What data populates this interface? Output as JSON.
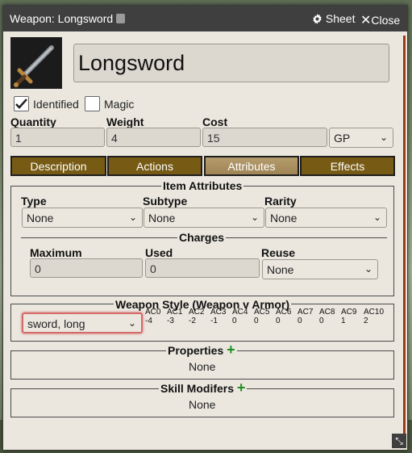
{
  "window": {
    "title": "Weapon: Longsword",
    "sheet_label": "Sheet",
    "close_label": "Close"
  },
  "item": {
    "name": "Longsword",
    "identified_label": "Identified",
    "identified": true,
    "magic_label": "Magic",
    "magic": false
  },
  "fields": {
    "quantity_label": "Quantity",
    "quantity": "1",
    "weight_label": "Weight",
    "weight": "4",
    "cost_label": "Cost",
    "cost": "15",
    "currency": "GP"
  },
  "tabs": [
    {
      "label": "Description"
    },
    {
      "label": "Actions"
    },
    {
      "label": "Attributes"
    },
    {
      "label": "Effects"
    }
  ],
  "attributes": {
    "title": "Item Attributes",
    "type_label": "Type",
    "type": "None",
    "subtype_label": "Subtype",
    "subtype": "None",
    "rarity_label": "Rarity",
    "rarity": "None"
  },
  "charges": {
    "title": "Charges",
    "maximum_label": "Maximum",
    "maximum": "0",
    "used_label": "Used",
    "used": "0",
    "reuse_label": "Reuse",
    "reuse": "None"
  },
  "weapon_style": {
    "title": "Weapon Style (Weapon v Armor)",
    "style": "sword, long",
    "ac": [
      {
        "h": "AC0",
        "v": "-4"
      },
      {
        "h": "AC1",
        "v": "-3"
      },
      {
        "h": "AC2",
        "v": "-2"
      },
      {
        "h": "AC3",
        "v": "-1"
      },
      {
        "h": "AC4",
        "v": "0"
      },
      {
        "h": "AC5",
        "v": "0"
      },
      {
        "h": "AC6",
        "v": "0"
      },
      {
        "h": "AC7",
        "v": "0"
      },
      {
        "h": "AC8",
        "v": "0"
      },
      {
        "h": "AC9",
        "v": "1"
      },
      {
        "h": "AC10",
        "v": "2"
      }
    ]
  },
  "properties": {
    "title": "Properties",
    "value": "None"
  },
  "skill_modifiers": {
    "title": "Skill Modifers",
    "value": "None"
  },
  "icons": {
    "gear": "gear-icon",
    "close": "close-icon",
    "resize": "resize-icon"
  },
  "colors": {
    "tab_bg": "#775b15",
    "tab_active_bg": "#a08556",
    "titlebar": "#3f3f3f",
    "plus": "#1f8f1f",
    "scrollbar": "#9b3b17"
  }
}
